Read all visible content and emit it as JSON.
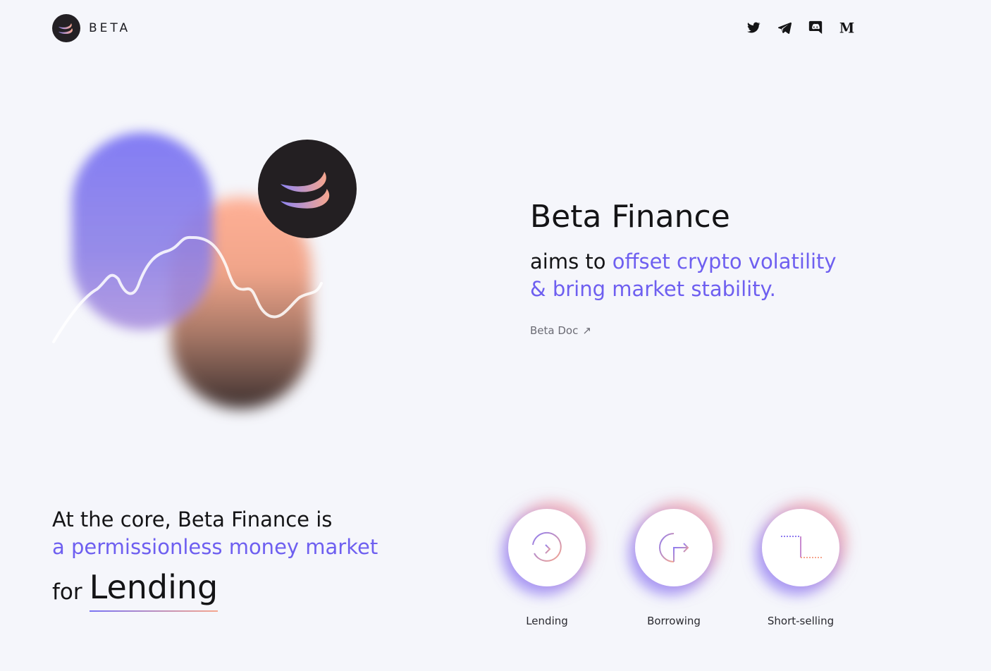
{
  "brand": {
    "name": "BETA"
  },
  "socials": [
    {
      "name": "twitter-icon"
    },
    {
      "name": "telegram-icon"
    },
    {
      "name": "discord-icon"
    },
    {
      "name": "medium-icon",
      "glyph": "M"
    }
  ],
  "hero": {
    "title": "Beta Finance",
    "sub_prefix": "aims to ",
    "sub_accent_1": "offset crypto volatility",
    "sub_accent_2": "& bring market stability.",
    "doc_link": "Beta Doc",
    "doc_arrow": "↗"
  },
  "core": {
    "line1": "At the core, Beta Finance is",
    "line2": "a permissionless money market",
    "for_label": "for",
    "highlight_word": "Lending"
  },
  "features": [
    {
      "label": "Lending",
      "icon": "lending-icon"
    },
    {
      "label": "Borrowing",
      "icon": "borrowing-icon"
    },
    {
      "label": "Short-selling",
      "icon": "short-selling-icon"
    }
  ],
  "colors": {
    "accent": "#6e5ff0",
    "background": "#f5f6fb",
    "dark": "#231f22",
    "peach": "#f6a68e"
  }
}
